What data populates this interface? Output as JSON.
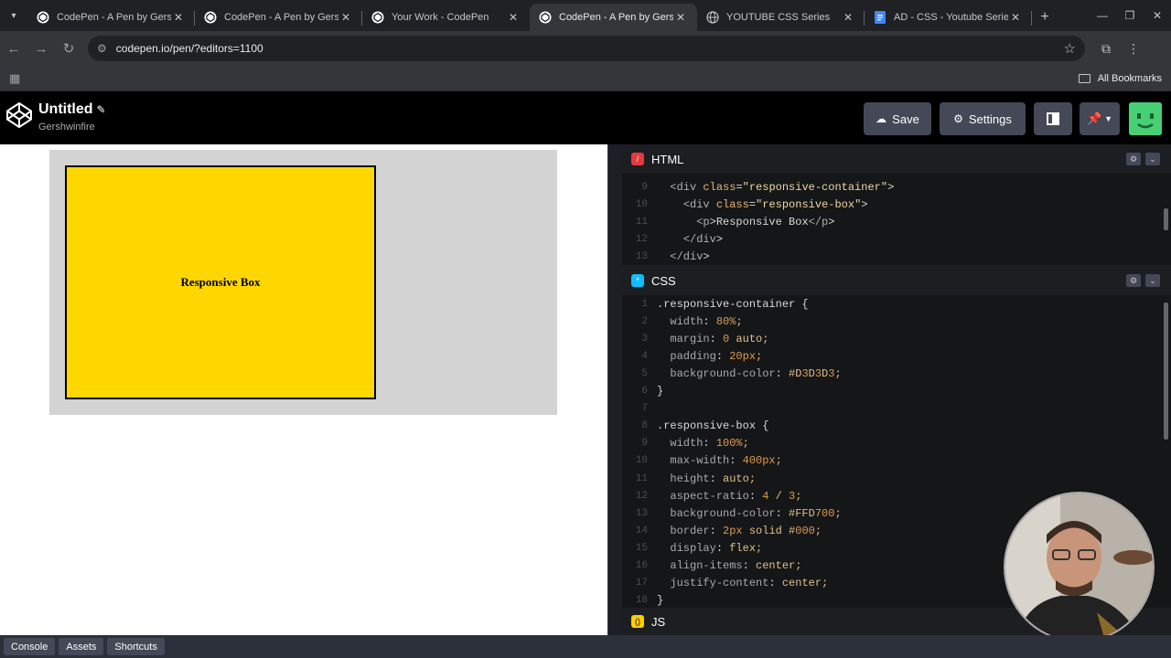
{
  "browser": {
    "tabs": [
      {
        "title": "CodePen - A Pen by Gershw",
        "favicon": "codepen-icon",
        "active": false
      },
      {
        "title": "CodePen - A Pen by Gershw",
        "favicon": "codepen-icon",
        "active": false
      },
      {
        "title": "Your Work - CodePen",
        "favicon": "codepen-icon",
        "active": false
      },
      {
        "title": "CodePen - A Pen by Gershw",
        "favicon": "codepen-icon",
        "active": true
      },
      {
        "title": "YOUTUBE CSS Series",
        "favicon": "globe-icon",
        "active": false
      },
      {
        "title": "AD - CSS - Youtube Series",
        "favicon": "docs-icon",
        "active": false
      }
    ],
    "url": "codepen.io/pen/?editors=1100",
    "bookmarks_label": "All Bookmarks"
  },
  "codepen": {
    "pen_title": "Untitled",
    "username": "Gershwinfire",
    "save_label": "Save",
    "settings_label": "Settings"
  },
  "preview": {
    "box_text": "Responsive Box",
    "container_color": "#D3D3D3",
    "box_color": "#FFD700"
  },
  "editors": {
    "html_label": "HTML",
    "css_label": "CSS",
    "js_label": "JS",
    "html_lines": [
      {
        "n": "9",
        "t": "  <div class=\"responsive-container\">"
      },
      {
        "n": "10",
        "t": "    <div class=\"responsive-box\">"
      },
      {
        "n": "11",
        "t": "      <p>Responsive Box</p>"
      },
      {
        "n": "12",
        "t": "    </div>"
      },
      {
        "n": "13",
        "t": "  </div>"
      }
    ],
    "css_lines": [
      {
        "n": "1",
        "t": ".responsive-container {"
      },
      {
        "n": "2",
        "t": "  width: 80%;"
      },
      {
        "n": "3",
        "t": "  margin: 0 auto;"
      },
      {
        "n": "4",
        "t": "  padding: 20px;"
      },
      {
        "n": "5",
        "t": "  background-color: #D3D3D3;"
      },
      {
        "n": "6",
        "t": "}"
      },
      {
        "n": "7",
        "t": ""
      },
      {
        "n": "8",
        "t": ".responsive-box {"
      },
      {
        "n": "9",
        "t": "  width: 100%;"
      },
      {
        "n": "10",
        "t": "  max-width: 400px;"
      },
      {
        "n": "11",
        "t": "  height: auto;"
      },
      {
        "n": "12",
        "t": "  aspect-ratio: 4 / 3;"
      },
      {
        "n": "13",
        "t": "  background-color: #FFD700;"
      },
      {
        "n": "14",
        "t": "  border: 2px solid #000;"
      },
      {
        "n": "15",
        "t": "  display: flex;"
      },
      {
        "n": "16",
        "t": "  align-items: center;"
      },
      {
        "n": "17",
        "t": "  justify-content: center;"
      },
      {
        "n": "18",
        "t": "}"
      }
    ]
  },
  "bottom_bar": {
    "console_label": "Console",
    "assets_label": "Assets",
    "shortcuts_label": "Shortcuts"
  }
}
